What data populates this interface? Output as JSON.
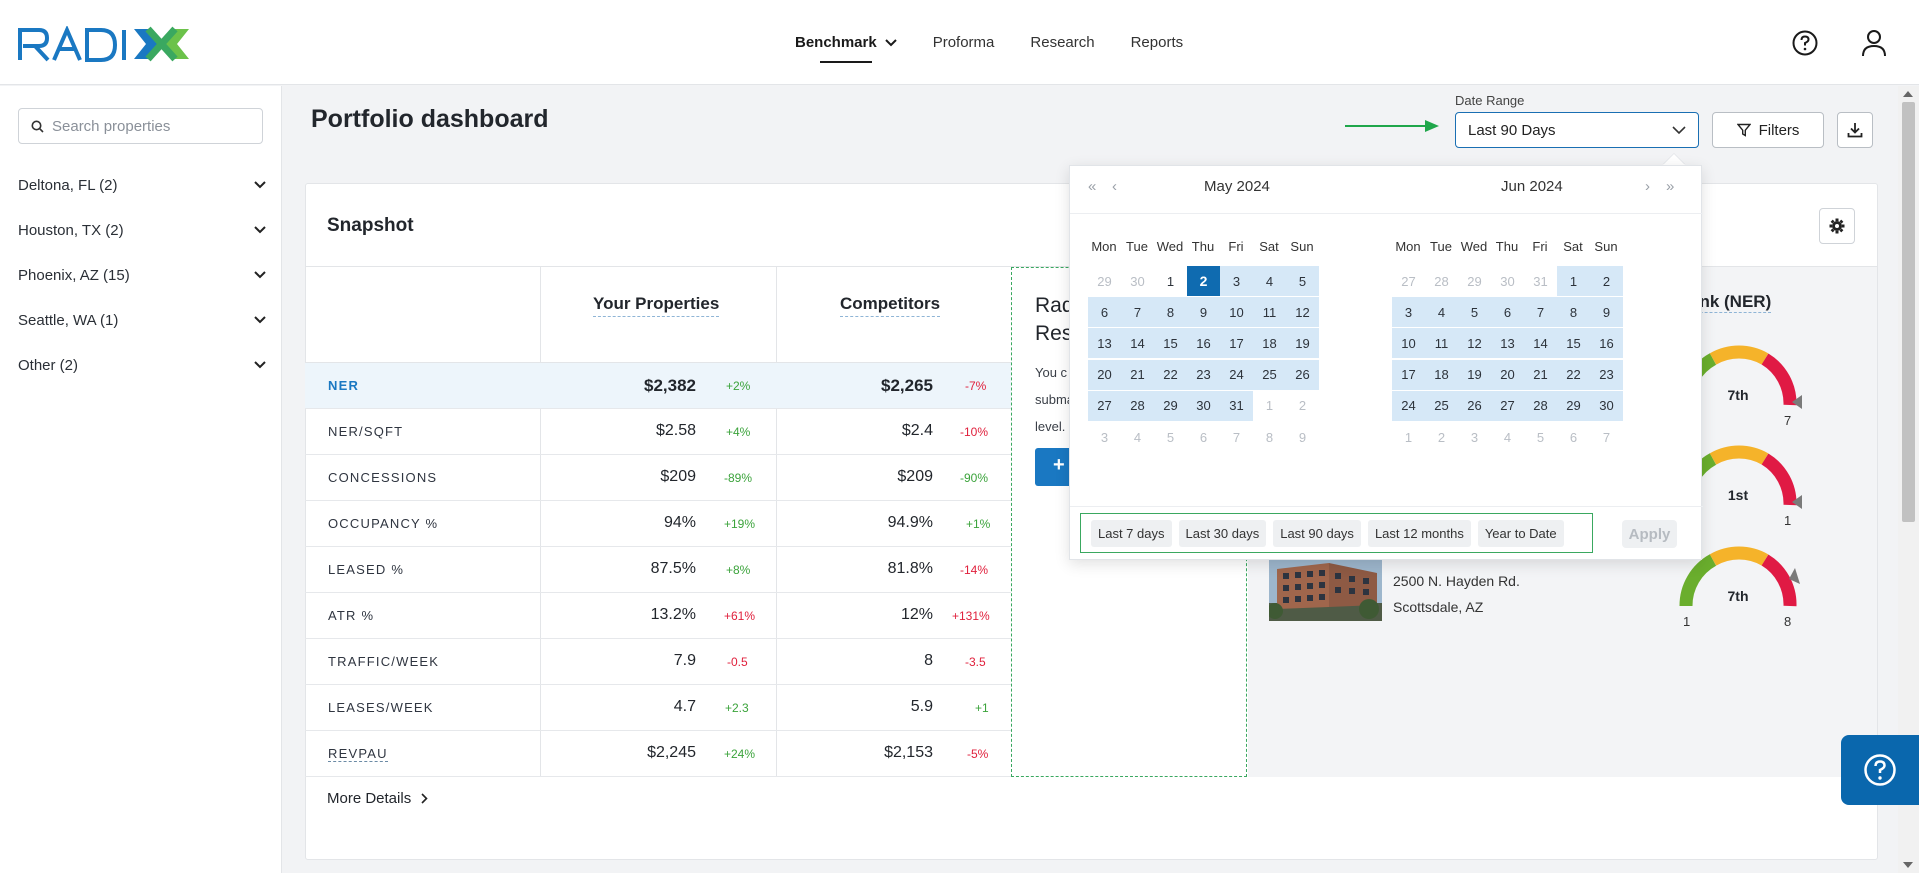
{
  "brand": {
    "logo_text": "RADIX",
    "accent": "#1a78c2",
    "green": "#3aa860"
  },
  "nav": {
    "items": [
      {
        "label": "Benchmark",
        "active": true,
        "has_dropdown": true
      },
      {
        "label": "Proforma"
      },
      {
        "label": "Research"
      },
      {
        "label": "Reports"
      }
    ],
    "icons": [
      "help-icon",
      "user-icon"
    ]
  },
  "sidebar": {
    "search_placeholder": "Search properties",
    "markets": [
      {
        "label": "Deltona, FL (2)"
      },
      {
        "label": "Houston, TX (2)"
      },
      {
        "label": "Phoenix, AZ (15)"
      },
      {
        "label": "Seattle, WA (1)"
      },
      {
        "label": "Other (2)"
      }
    ]
  },
  "header": {
    "title": "Portfolio dashboard",
    "date_range_label": "Date Range",
    "date_range_value": "Last 90 Days",
    "filters_label": "Filters"
  },
  "snapshot": {
    "title": "Snapshot",
    "columns": [
      "Your Properties",
      "Competitors"
    ],
    "rows": [
      {
        "metric": "NER",
        "yours": "$2,382",
        "yours_chg": "+2%",
        "comp": "$2,265",
        "comp_chg": "-7%"
      },
      {
        "metric": "NER/SQFT",
        "yours": "$2.58",
        "yours_chg": "+4%",
        "comp": "$2.4",
        "comp_chg": "-10%"
      },
      {
        "metric": "CONCESSIONS",
        "yours": "$209",
        "yours_chg": "-89%",
        "comp": "$209",
        "comp_chg": "-90%"
      },
      {
        "metric": "OCCUPANCY %",
        "yours": "94%",
        "yours_chg": "+19%",
        "comp": "94.9%",
        "comp_chg": "+1%"
      },
      {
        "metric": "LEASED %",
        "yours": "87.5%",
        "yours_chg": "+8%",
        "comp": "81.8%",
        "comp_chg": "-14%"
      },
      {
        "metric": "ATR %",
        "yours": "13.2%",
        "yours_chg": "+61%",
        "comp": "12%",
        "comp_chg": "+131%"
      },
      {
        "metric": "TRAFFIC/WEEK",
        "yours": "7.9",
        "yours_chg": "-0.5",
        "comp": "8",
        "comp_chg": "-3.5"
      },
      {
        "metric": "LEASES/WEEK",
        "yours": "4.7",
        "yours_chg": "+2.3",
        "comp": "5.9",
        "comp_chg": "+1"
      },
      {
        "metric": "REVPAU",
        "yours": "$2,245",
        "yours_chg": "+24%",
        "comp": "$2,153",
        "comp_chg": "-5%"
      }
    ],
    "more_details": "More Details"
  },
  "radix_promo": {
    "title_line1": "Rad",
    "title_line2": "Res",
    "text_line1": "You c",
    "text_line2": "subma",
    "text_line3": "level.",
    "button": "+"
  },
  "rank_panel": {
    "title": "ank (NER)",
    "gauges": [
      {
        "rank": "7th",
        "lo": "",
        "hi": "7"
      },
      {
        "rank": "1st",
        "lo": "",
        "hi": "1"
      },
      {
        "rank": "7th",
        "lo": "1",
        "hi": "8"
      }
    ],
    "property": {
      "address1": "2500 N. Hayden Rd.",
      "address2": "Scottsdale, AZ"
    }
  },
  "date_picker": {
    "left_month": "May 2024",
    "right_month": "Jun 2024",
    "weekdays": [
      "Mon",
      "Tue",
      "Wed",
      "Thu",
      "Fri",
      "Sat",
      "Sun"
    ],
    "left_days": [
      [
        "29",
        "30",
        "1",
        "2",
        "3",
        "4",
        "5"
      ],
      [
        "6",
        "7",
        "8",
        "9",
        "10",
        "11",
        "12"
      ],
      [
        "13",
        "14",
        "15",
        "16",
        "17",
        "18",
        "19"
      ],
      [
        "20",
        "21",
        "22",
        "23",
        "24",
        "25",
        "26"
      ],
      [
        "27",
        "28",
        "29",
        "30",
        "31",
        "1",
        "2"
      ],
      [
        "3",
        "4",
        "5",
        "6",
        "7",
        "8",
        "9"
      ]
    ],
    "right_days": [
      [
        "27",
        "28",
        "29",
        "30",
        "31",
        "1",
        "2"
      ],
      [
        "3",
        "4",
        "5",
        "6",
        "7",
        "8",
        "9"
      ],
      [
        "10",
        "11",
        "12",
        "13",
        "14",
        "15",
        "16"
      ],
      [
        "17",
        "18",
        "19",
        "20",
        "21",
        "22",
        "23"
      ],
      [
        "24",
        "25",
        "26",
        "27",
        "28",
        "29",
        "30"
      ],
      [
        "1",
        "2",
        "3",
        "4",
        "5",
        "6",
        "7"
      ]
    ],
    "selected_start": "May 2",
    "presets": [
      "Last 7 days",
      "Last 30 days",
      "Last 90 days",
      "Last 12 months",
      "Year to Date"
    ],
    "apply_label": "Apply"
  },
  "help_fab_icon": "help-circle-icon"
}
